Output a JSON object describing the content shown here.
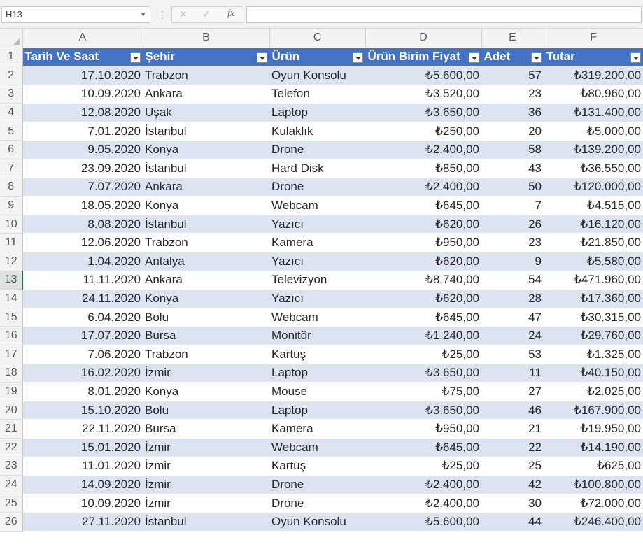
{
  "formula_bar": {
    "name_box": "H13",
    "cancel_icon": "✕",
    "enter_icon": "✓",
    "fx_label": "fx",
    "formula": ""
  },
  "columns": [
    "A",
    "B",
    "C",
    "D",
    "E",
    "F"
  ],
  "headers": [
    "Tarih Ve Saat",
    "Şehir",
    "Ürün",
    "Ürün Birim Fiyat",
    "Adet",
    "Tutar"
  ],
  "active_row": "13",
  "colors": {
    "header_fill": "#4472c4",
    "band_fill": "#dce4f2",
    "active_accent": "#217346"
  },
  "rows": [
    {
      "n": "2",
      "date": "17.10.2020",
      "city": "Trabzon",
      "product": "Oyun Konsolu",
      "price": "₺5.600,00",
      "qty": "57",
      "total": "₺319.200,00"
    },
    {
      "n": "3",
      "date": "10.09.2020",
      "city": "Ankara",
      "product": "Telefon",
      "price": "₺3.520,00",
      "qty": "23",
      "total": "₺80.960,00"
    },
    {
      "n": "4",
      "date": "12.08.2020",
      "city": "Uşak",
      "product": "Laptop",
      "price": "₺3.650,00",
      "qty": "36",
      "total": "₺131.400,00"
    },
    {
      "n": "5",
      "date": "7.01.2020",
      "city": "İstanbul",
      "product": "Kulaklık",
      "price": "₺250,00",
      "qty": "20",
      "total": "₺5.000,00"
    },
    {
      "n": "6",
      "date": "9.05.2020",
      "city": "Konya",
      "product": "Drone",
      "price": "₺2.400,00",
      "qty": "58",
      "total": "₺139.200,00"
    },
    {
      "n": "7",
      "date": "23.09.2020",
      "city": "İstanbul",
      "product": "Hard Disk",
      "price": "₺850,00",
      "qty": "43",
      "total": "₺36.550,00"
    },
    {
      "n": "8",
      "date": "7.07.2020",
      "city": "Ankara",
      "product": "Drone",
      "price": "₺2.400,00",
      "qty": "50",
      "total": "₺120.000,00"
    },
    {
      "n": "9",
      "date": "18.05.2020",
      "city": "Konya",
      "product": "Webcam",
      "price": "₺645,00",
      "qty": "7",
      "total": "₺4.515,00"
    },
    {
      "n": "10",
      "date": "8.08.2020",
      "city": "İstanbul",
      "product": "Yazıcı",
      "price": "₺620,00",
      "qty": "26",
      "total": "₺16.120,00"
    },
    {
      "n": "11",
      "date": "12.06.2020",
      "city": "Trabzon",
      "product": "Kamera",
      "price": "₺950,00",
      "qty": "23",
      "total": "₺21.850,00"
    },
    {
      "n": "12",
      "date": "1.04.2020",
      "city": "Antalya",
      "product": "Yazıcı",
      "price": "₺620,00",
      "qty": "9",
      "total": "₺5.580,00"
    },
    {
      "n": "13",
      "date": "11.11.2020",
      "city": "Ankara",
      "product": "Televizyon",
      "price": "₺8.740,00",
      "qty": "54",
      "total": "₺471.960,00"
    },
    {
      "n": "14",
      "date": "24.11.2020",
      "city": "Konya",
      "product": "Yazıcı",
      "price": "₺620,00",
      "qty": "28",
      "total": "₺17.360,00"
    },
    {
      "n": "15",
      "date": "6.04.2020",
      "city": "Bolu",
      "product": "Webcam",
      "price": "₺645,00",
      "qty": "47",
      "total": "₺30.315,00"
    },
    {
      "n": "16",
      "date": "17.07.2020",
      "city": "Bursa",
      "product": "Monitör",
      "price": "₺1.240,00",
      "qty": "24",
      "total": "₺29.760,00"
    },
    {
      "n": "17",
      "date": "7.06.2020",
      "city": "Trabzon",
      "product": "Kartuş",
      "price": "₺25,00",
      "qty": "53",
      "total": "₺1.325,00"
    },
    {
      "n": "18",
      "date": "16.02.2020",
      "city": "İzmir",
      "product": "Laptop",
      "price": "₺3.650,00",
      "qty": "11",
      "total": "₺40.150,00"
    },
    {
      "n": "19",
      "date": "8.01.2020",
      "city": "Konya",
      "product": "Mouse",
      "price": "₺75,00",
      "qty": "27",
      "total": "₺2.025,00"
    },
    {
      "n": "20",
      "date": "15.10.2020",
      "city": "Bolu",
      "product": "Laptop",
      "price": "₺3.650,00",
      "qty": "46",
      "total": "₺167.900,00"
    },
    {
      "n": "21",
      "date": "22.11.2020",
      "city": "Bursa",
      "product": "Kamera",
      "price": "₺950,00",
      "qty": "21",
      "total": "₺19.950,00"
    },
    {
      "n": "22",
      "date": "15.01.2020",
      "city": "İzmir",
      "product": "Webcam",
      "price": "₺645,00",
      "qty": "22",
      "total": "₺14.190,00"
    },
    {
      "n": "23",
      "date": "11.01.2020",
      "city": "İzmir",
      "product": "Kartuş",
      "price": "₺25,00",
      "qty": "25",
      "total": "₺625,00"
    },
    {
      "n": "24",
      "date": "14.09.2020",
      "city": "İzmir",
      "product": "Drone",
      "price": "₺2.400,00",
      "qty": "42",
      "total": "₺100.800,00"
    },
    {
      "n": "25",
      "date": "10.09.2020",
      "city": "İzmir",
      "product": "Drone",
      "price": "₺2.400,00",
      "qty": "30",
      "total": "₺72.000,00"
    },
    {
      "n": "26",
      "date": "27.11.2020",
      "city": "İstanbul",
      "product": "Oyun Konsolu",
      "price": "₺5.600,00",
      "qty": "44",
      "total": "₺246.400,00"
    }
  ]
}
